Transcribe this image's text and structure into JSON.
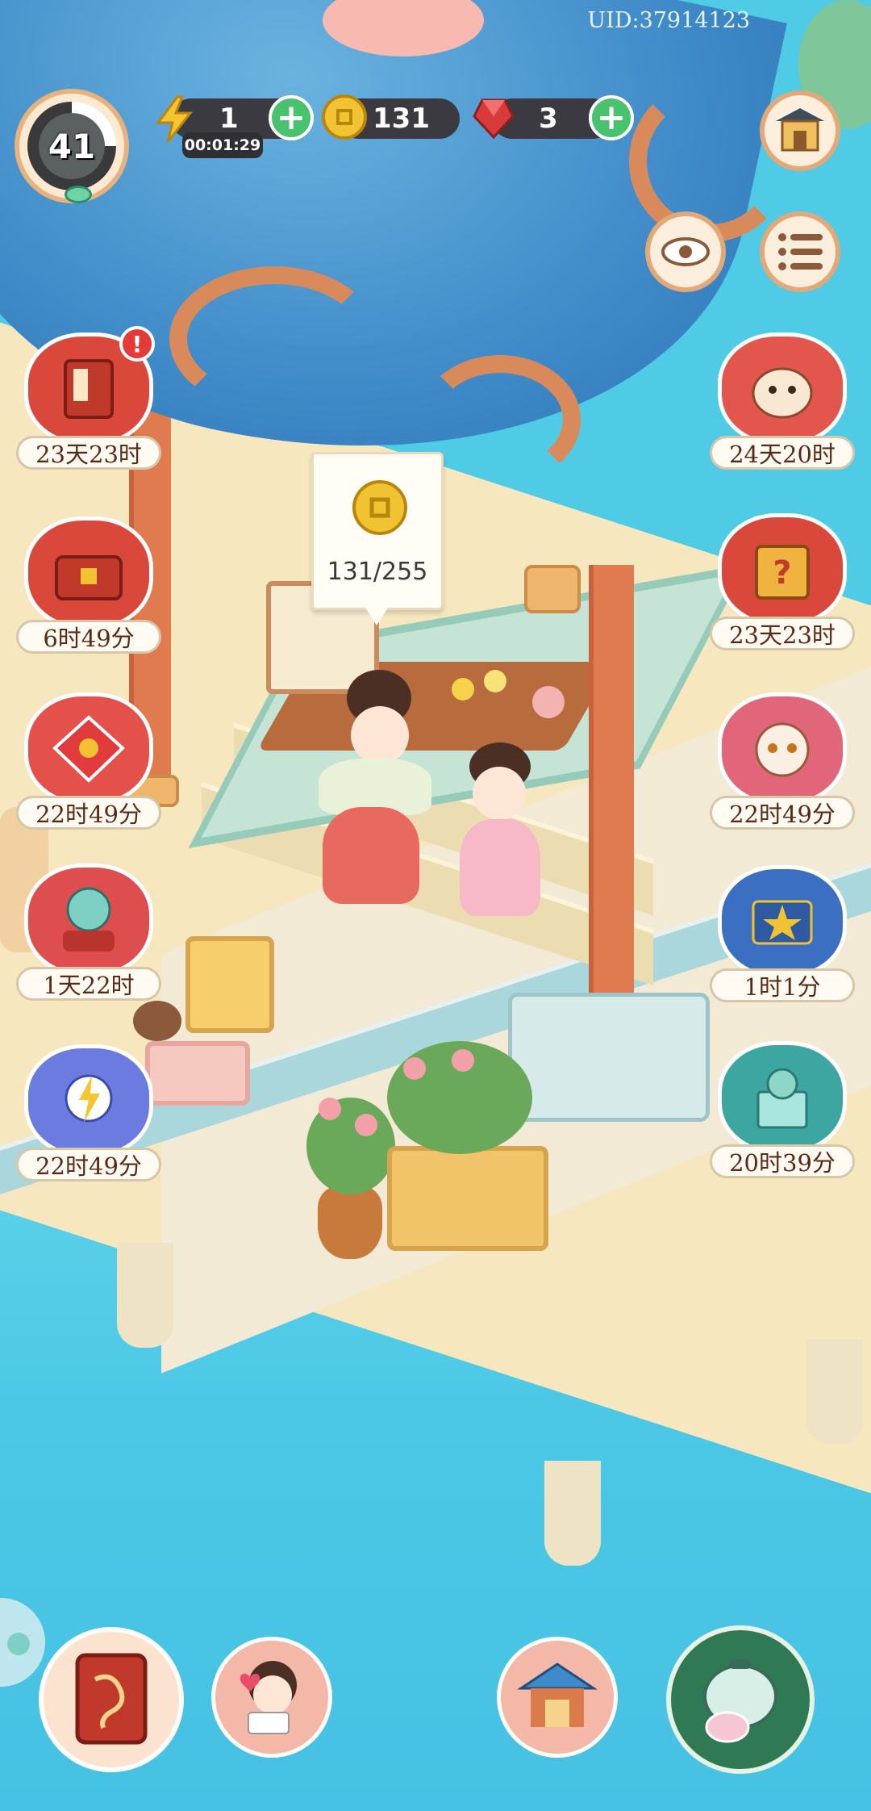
{
  "uid": "UID:37914123",
  "level": "41",
  "resources": {
    "energy": {
      "value": "1",
      "timer": "00:01:29"
    },
    "coins": {
      "value": "131"
    },
    "gems": {
      "value": "3"
    }
  },
  "coin_popup": {
    "count": "131/255"
  },
  "left_events": [
    {
      "name": "event-book",
      "label": "23天23时",
      "color": "#d9483b"
    },
    {
      "name": "event-treasure-box",
      "label": "6时49分",
      "color": "#d9483b"
    },
    {
      "name": "event-koi-kite",
      "label": "22时49分",
      "color": "#e4504a"
    },
    {
      "name": "event-cat-drum",
      "label": "1天22时",
      "color": "#de4e4e"
    },
    {
      "name": "event-lightning-cat",
      "label": "22时49分",
      "color": "#6c7be0"
    }
  ],
  "right_events": [
    {
      "name": "event-hamster",
      "label": "24天20时",
      "color": "#e2564e"
    },
    {
      "name": "event-mystery-box",
      "label": "23天23时",
      "color": "#d9483b"
    },
    {
      "name": "event-cat-portrait",
      "label": "22时49分",
      "color": "#e2667a"
    },
    {
      "name": "event-star-book",
      "label": "1时1分",
      "color": "#3a6fc2"
    },
    {
      "name": "event-cat-gift",
      "label": "20时39分",
      "color": "#3ea6a0"
    }
  ],
  "colors": {
    "water": "#4fcbe6",
    "deck": "#f6e7bf",
    "roof": "#3f8ac8",
    "pillar": "#e07a4f",
    "plus_green": "#49c26d",
    "coin_gold": "#f1c232",
    "gem_red": "#d83a3a"
  }
}
